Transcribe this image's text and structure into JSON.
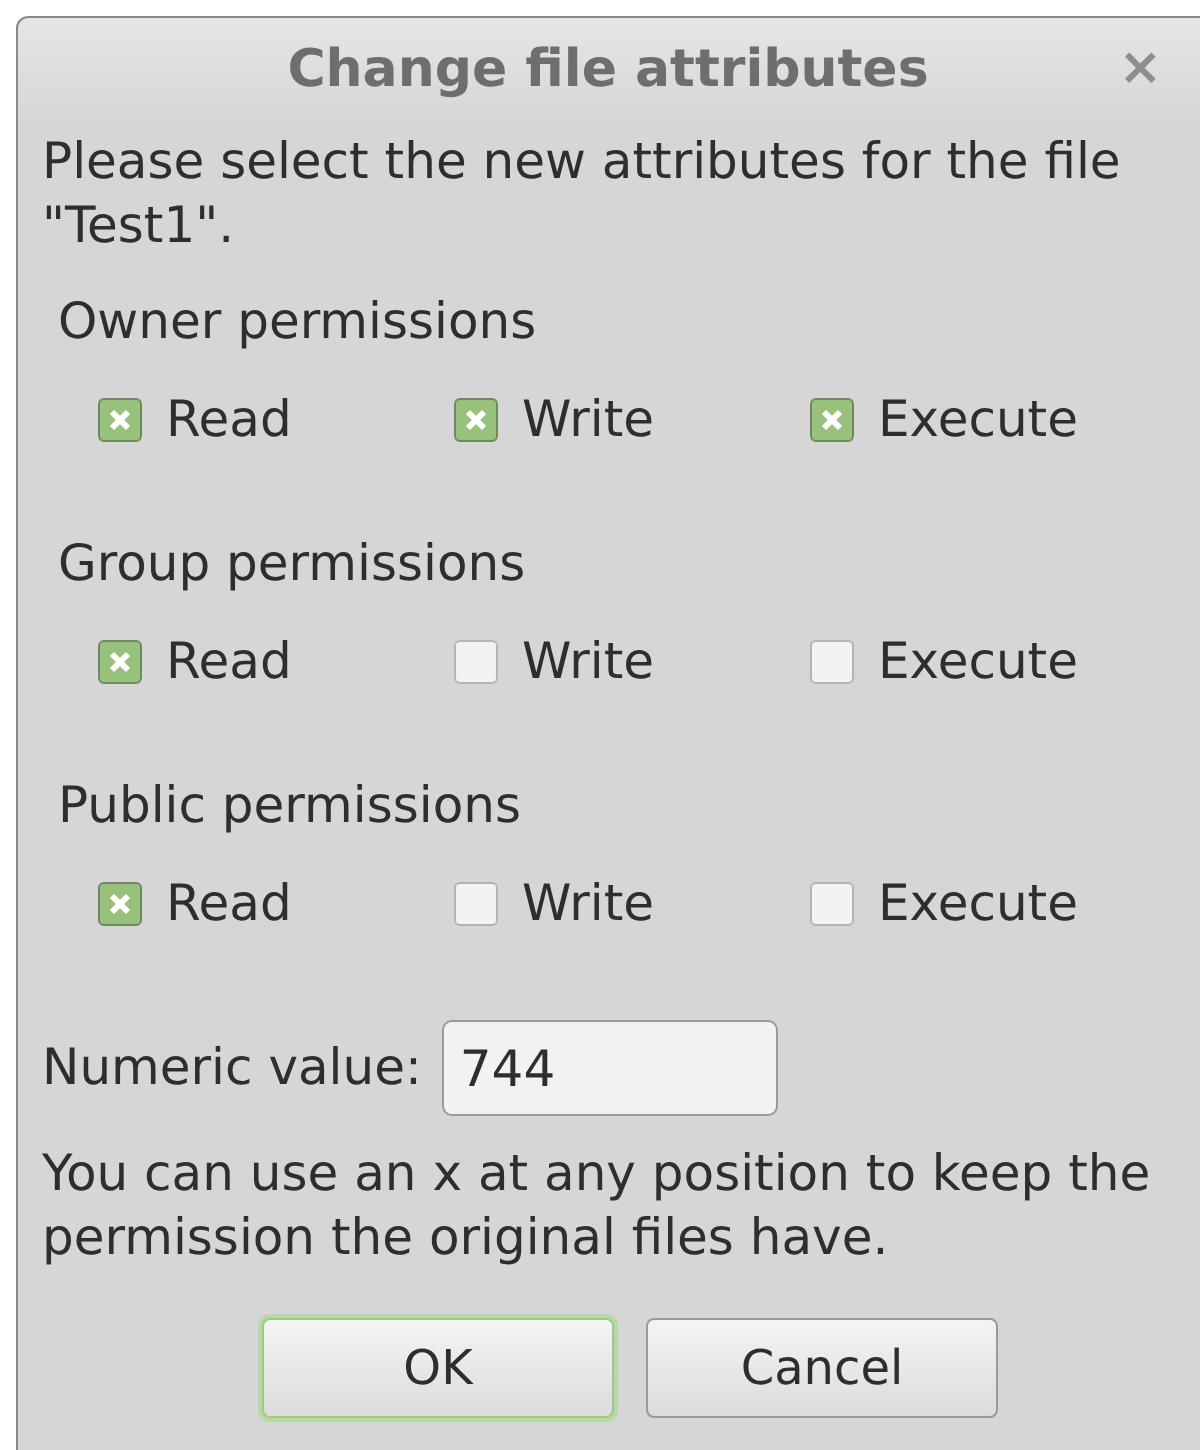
{
  "window": {
    "title": "Change file attributes",
    "close": "×"
  },
  "message": "Please select the new attributes for the file \"Test1\".",
  "groups": [
    {
      "label": "Owner permissions",
      "options": [
        {
          "label": "Read",
          "checked": true
        },
        {
          "label": "Write",
          "checked": true
        },
        {
          "label": "Execute",
          "checked": true
        }
      ]
    },
    {
      "label": "Group permissions",
      "options": [
        {
          "label": "Read",
          "checked": true
        },
        {
          "label": "Write",
          "checked": false
        },
        {
          "label": "Execute",
          "checked": false
        }
      ]
    },
    {
      "label": "Public permissions",
      "options": [
        {
          "label": "Read",
          "checked": true
        },
        {
          "label": "Write",
          "checked": false
        },
        {
          "label": "Execute",
          "checked": false
        }
      ]
    }
  ],
  "numeric": {
    "label": "Numeric value:",
    "value": "744"
  },
  "hint": "You can use an x at any position to keep the permission the original files have.",
  "buttons": [
    {
      "label": "OK",
      "focused": true
    },
    {
      "label": "Cancel",
      "focused": false
    }
  ]
}
